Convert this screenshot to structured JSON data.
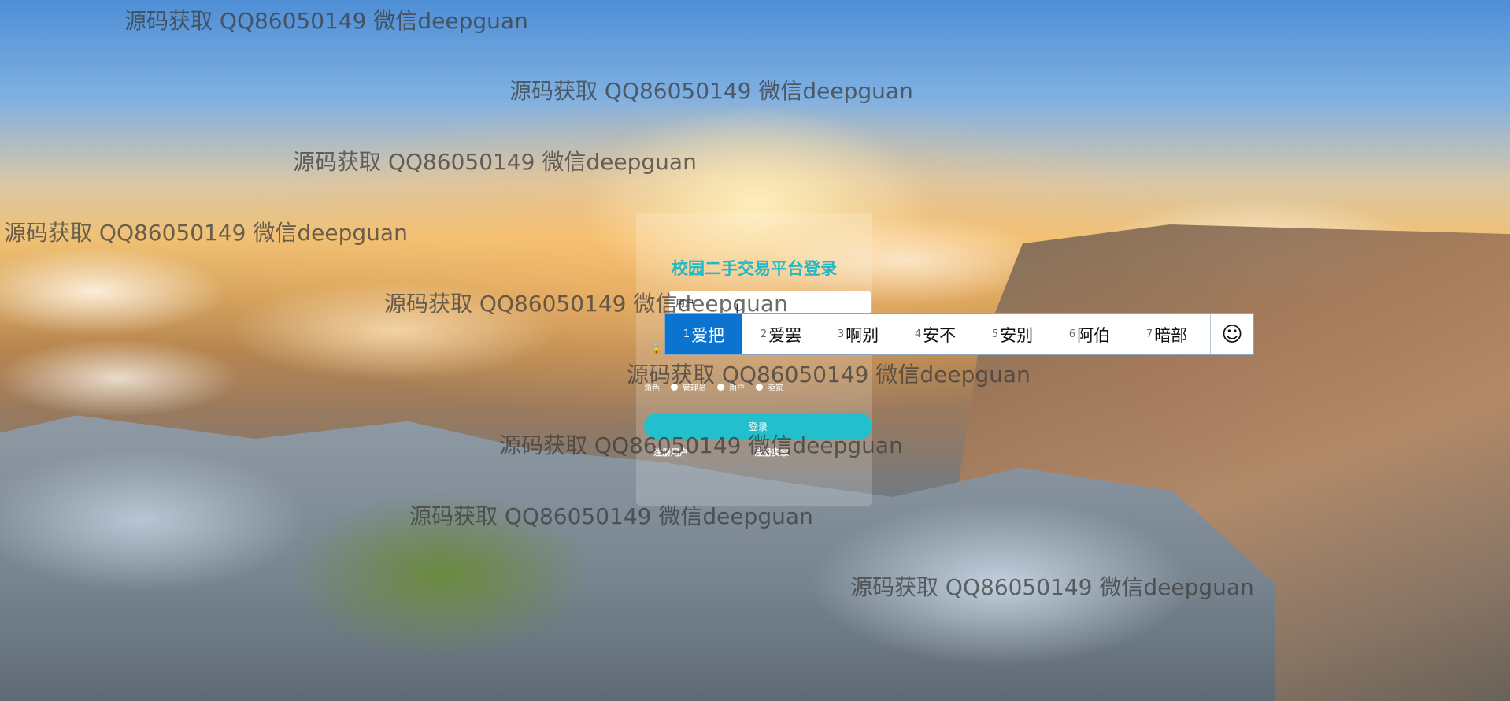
{
  "page": {
    "title": "校园二手交易平台登录",
    "login_button": "登录",
    "role_label": "角色",
    "roles": [
      "管理员",
      "用户",
      "卖家"
    ],
    "register_user": "注册用户",
    "register_seller": "注册卖家",
    "username_value": "用户"
  },
  "watermark_text": "源码获取 QQ86050149 微信deepguan",
  "ime": {
    "candidates": [
      {
        "num": "1",
        "text": "爱把"
      },
      {
        "num": "2",
        "text": "爱罢"
      },
      {
        "num": "3",
        "text": "啊别"
      },
      {
        "num": "4",
        "text": "安不"
      },
      {
        "num": "5",
        "text": "安别"
      },
      {
        "num": "6",
        "text": "阿伯"
      },
      {
        "num": "7",
        "text": "暗部"
      }
    ],
    "selected_index": 0,
    "emoji_glyph": "☺"
  },
  "colors": {
    "accent": "#22bfcc",
    "ime_highlight": "#0b74d1"
  }
}
